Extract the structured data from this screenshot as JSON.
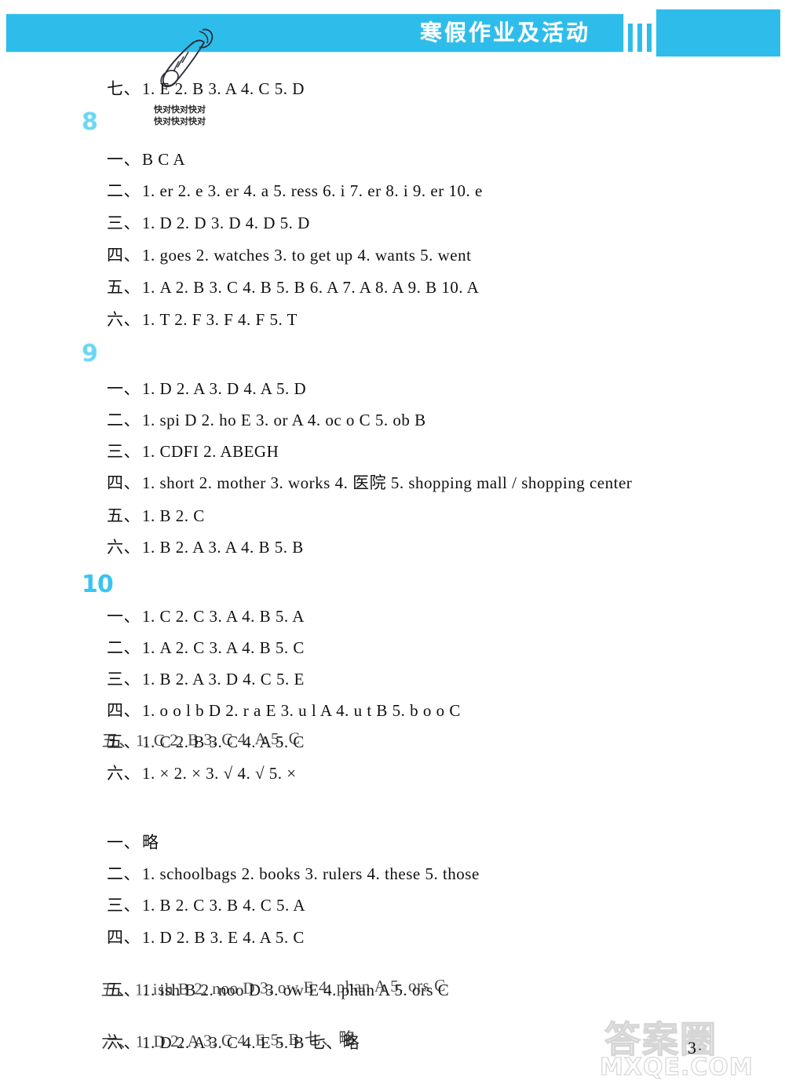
{
  "header": {
    "title": "寒假作业及活动",
    "banner_color": "#2ebdea"
  },
  "doodle": {
    "icon": "carrot-doodle",
    "note_line1": "快对快对快对",
    "note_line2": "快对快对快对"
  },
  "top_answer": {
    "label": "七、",
    "text": "1. E  2. B   3. A   4. C   5. D"
  },
  "sections": [
    {
      "number": "8",
      "lines": [
        {
          "label": "一、",
          "text": "B   C   A"
        },
        {
          "label": "二、",
          "text": "1. er   2. e   3. er   4. a   5. ress   6. i   7. er   8. i   9. er   10. e"
        },
        {
          "label": "三、",
          "text": "1. D   2. D   3. D   4. D   5. D"
        },
        {
          "label": "四、",
          "text": "1. goes   2. watches   3. to get up   4. wants   5. went"
        },
        {
          "label": "五、",
          "text": "1. A   2. B   3. C   4. B   5. B   6. A   7. A   8. A   9. B   10. A"
        },
        {
          "label": "六、",
          "text": "1. T   2. F   3. F   4. F   5. T"
        }
      ]
    },
    {
      "number": "9",
      "lines": [
        {
          "label": "一、",
          "text": "1. D   2. A   3. D   4. A   5. D"
        },
        {
          "label": "二、",
          "text": "1. spi D   2. ho E   3. or A   4. oc o C   5. ob B"
        },
        {
          "label": "三、",
          "text": "1. CDFI   2. ABEGH"
        },
        {
          "label": "四、",
          "text": "1. short   2. mother   3. works   4. 医院   5. shopping mall / shopping center"
        },
        {
          "label": "五、",
          "text": "1. B   2. C"
        },
        {
          "label": "六、",
          "text": "1. B   2. A   3. A   4. B   5. B"
        }
      ]
    },
    {
      "number": "10",
      "lines": [
        {
          "label": "一、",
          "text": "1. C   2. C   3. A   4. B   5. A"
        },
        {
          "label": "二、",
          "text": "1. A   2. C   3. A   4. B   5. C"
        },
        {
          "label": "三、",
          "text": "1. B   2. A   3. D   4. C   5. E"
        },
        {
          "label": "四、",
          "text": "1. o o l b D   2. r a E   3. u l A   4. u t B   5. b o o C"
        },
        {
          "label": "五、",
          "text": "1. C   2. B   3. C   4. A   5. C",
          "ghosted": true
        },
        {
          "label": "六、",
          "text": "1. ×   2. ×   3. √   4. √   5. ×"
        }
      ]
    },
    {
      "number": "",
      "lines": [
        {
          "label": "一、",
          "text": "略"
        },
        {
          "label": "二、",
          "text": "1. schoolbags   2. books   3. rulers   4. these   5. those"
        },
        {
          "label": "三、",
          "text": "1. B   2. C   3. B   4. C   5. A"
        },
        {
          "label": "四、",
          "text": "1. D   2. B   3. E   4. A   5. C"
        },
        {
          "label": "五、",
          "text": "1. ish B   2. noo D   3. ow E   4. phan A   5. ors C",
          "ghosted": true
        },
        {
          "label": "六、",
          "text": "1. D   2. A   3. C   4. E   5. B   七、略",
          "ghosted": true
        }
      ]
    }
  ],
  "footer": {
    "watermark_cn": "答案圈",
    "watermark_en": "MXQE.COM",
    "page_number": "3"
  }
}
